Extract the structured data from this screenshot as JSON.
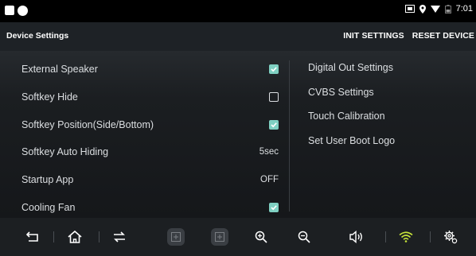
{
  "status": {
    "time": "7:01"
  },
  "header": {
    "title": "Device Settings",
    "init_label": "INIT SETTINGS",
    "reset_label": "RESET DEVICE"
  },
  "settings": [
    {
      "label": "External Speaker",
      "type": "checkbox",
      "checked": true
    },
    {
      "label": "Softkey Hide",
      "type": "checkbox",
      "checked": false
    },
    {
      "label": "Softkey Position(Side/Bottom)",
      "type": "checkbox",
      "checked": true
    },
    {
      "label": "Softkey Auto Hiding",
      "type": "value",
      "value": "5sec"
    },
    {
      "label": "Startup App",
      "type": "value",
      "value": "OFF"
    },
    {
      "label": "Cooling Fan",
      "type": "checkbox",
      "checked": true
    }
  ],
  "right_menu": [
    {
      "label": "Digital Out Settings"
    },
    {
      "label": "CVBS Settings"
    },
    {
      "label": "Touch Calibration"
    },
    {
      "label": "Set User Boot Logo"
    }
  ],
  "navbar": {
    "buttons": [
      "back-icon",
      "home-icon",
      "recent-apps-icon",
      "grid-icon",
      "grid-icon",
      "zoom-in-icon",
      "zoom-out-icon",
      "volume-icon",
      "wifi-icon",
      "settings-icon"
    ]
  },
  "colors": {
    "checkbox_accent": "#7fd0c2",
    "wifi_accent": "#c6e33a"
  }
}
